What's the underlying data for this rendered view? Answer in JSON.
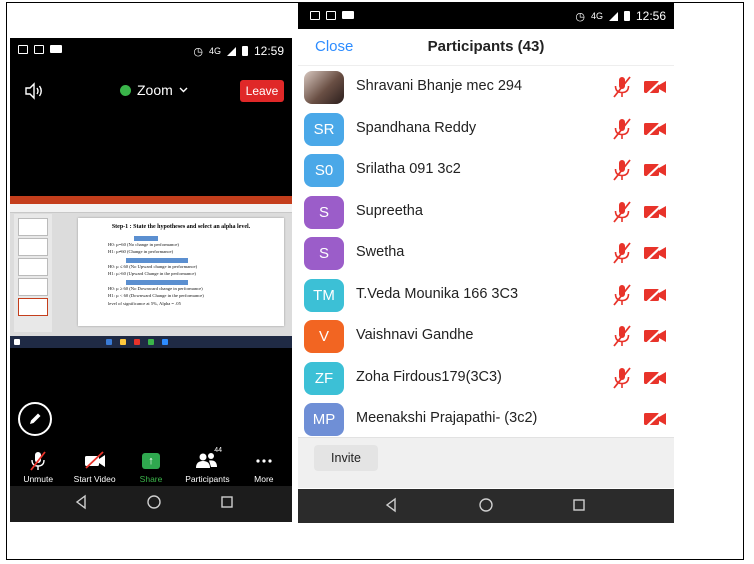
{
  "left_phone": {
    "status_bar": {
      "network": "4G",
      "time": "12:59"
    },
    "meeting_name": "Zoom",
    "leave_label": "Leave",
    "slide": {
      "title": "Step-1 : State the hypotheses and select an alpha level.",
      "lines": [
        "H0: µ=60 (No change in performance)",
        "H1: µ≠60 (Change in performance)",
        "H0: µ ≤ 60 (No Upward change in performance)",
        "H1: µ>60 (Upward Change in the performance)",
        "H0: µ ≥ 60 (No Downward change in performance)",
        "H1: µ < 60 (Downward Change in the performance)",
        "level of significance at 5%, Alpha = .05"
      ]
    },
    "toolbar": [
      {
        "label": "Unmute",
        "icon": "mic-muted-icon"
      },
      {
        "label": "Start Video",
        "icon": "video-off-icon"
      },
      {
        "label": "Share",
        "icon": "share-icon"
      },
      {
        "label": "Participants",
        "icon": "participants-icon",
        "badge": "44"
      },
      {
        "label": "More",
        "icon": "more-icon"
      }
    ]
  },
  "right_phone": {
    "status_bar": {
      "network": "4G",
      "time": "12:56"
    },
    "close_label": "Close",
    "title": "Participants (43)",
    "participants": [
      {
        "initials": "",
        "name": "Shravani Bhanje mec 294",
        "color": "",
        "photo": true,
        "mic_muted": true,
        "video_off": true
      },
      {
        "initials": "SR",
        "name": "Spandhana Reddy",
        "color": "#4aa8e8",
        "photo": false,
        "mic_muted": true,
        "video_off": true
      },
      {
        "initials": "S0",
        "name": "Srilatha 091 3c2",
        "color": "#4aa8e8",
        "photo": false,
        "mic_muted": true,
        "video_off": true
      },
      {
        "initials": "S",
        "name": "Supreetha",
        "color": "#9b5dc9",
        "photo": false,
        "mic_muted": true,
        "video_off": true
      },
      {
        "initials": "S",
        "name": "Swetha",
        "color": "#9b5dc9",
        "photo": false,
        "mic_muted": true,
        "video_off": true
      },
      {
        "initials": "TM",
        "name": "T.Veda Mounika 166 3C3",
        "color": "#3cc0d6",
        "photo": false,
        "mic_muted": true,
        "video_off": true
      },
      {
        "initials": "V",
        "name": "Vaishnavi Gandhe",
        "color": "#f26522",
        "photo": false,
        "mic_muted": true,
        "video_off": true
      },
      {
        "initials": "ZF",
        "name": "Zoha Firdous179(3C3)",
        "color": "#3cc0d6",
        "photo": false,
        "mic_muted": true,
        "video_off": true
      },
      {
        "initials": "MP",
        "name": "Meenakshi Prajapathi- (3c2)",
        "color": "#6f8fd6",
        "photo": false,
        "mic_muted": false,
        "video_off": true
      }
    ],
    "invite_label": "Invite"
  },
  "colors": {
    "zoom_blue": "#2d8cff",
    "leave_red": "#e02828",
    "share_green": "#2fa84f",
    "muted_red": "#e8332a"
  }
}
